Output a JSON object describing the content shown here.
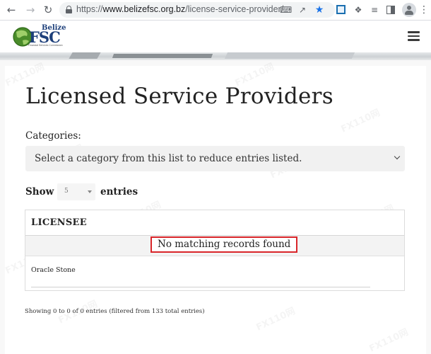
{
  "browser": {
    "url_scheme": "https://",
    "url_host": "www.belizefsc.org.bz",
    "url_path": "/license-service-provider/"
  },
  "site": {
    "logo_belize": "Belize",
    "logo_fsc": "FSC",
    "logo_tagline": "Financial Services Commission"
  },
  "page": {
    "title": "Licensed Service Providers",
    "categories_label": "Categories:",
    "category_select_value": "Select a category from this list to reduce entries listed.",
    "length": {
      "show_label": "Show",
      "selected": "5",
      "entries_label": "entries"
    },
    "table": {
      "columns": [
        "LICENSEE"
      ],
      "empty_message": "No matching records found",
      "rows": [
        "Oracle Stone"
      ]
    },
    "info": "Showing 0 to 0 of 0 entries (filtered from 133 total entries)"
  },
  "watermark": "FX110网",
  "colors": {
    "brand_navy": "#1d3f7a",
    "logo_green": "#4a8c2a",
    "highlight_red": "#d9262a",
    "bookmark_blue": "#1a73e8"
  },
  "icons": [
    "back-arrow-icon",
    "forward-arrow-icon",
    "reload-icon",
    "lock-icon",
    "translate-icon",
    "share-icon",
    "star-icon",
    "extension-icon",
    "puzzle-icon",
    "reading-list-icon",
    "side-panel-icon",
    "profile-icon",
    "kebab-menu-icon",
    "hamburger-menu-icon",
    "chevron-down-icon",
    "caret-down-icon"
  ]
}
